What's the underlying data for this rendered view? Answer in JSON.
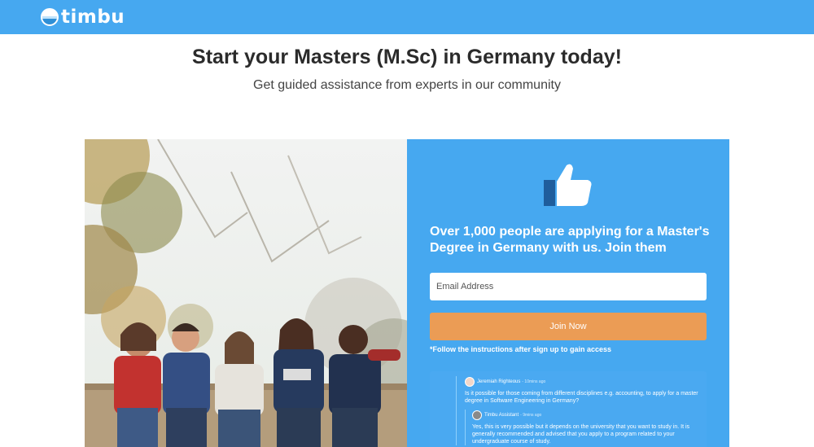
{
  "brand": {
    "name": "timbu"
  },
  "hero": {
    "title": "Start your Masters (M.Sc) in Germany today!",
    "subtitle": "Get guided assistance from experts in our community"
  },
  "signup": {
    "title": "Over 1,000 people are applying for a Master's Degree in Germany with us. Join them",
    "email_placeholder": "Email Address",
    "button_label": "Join Now",
    "note": "*Follow the instructions after sign up to gain access"
  },
  "chat": {
    "messages": [
      {
        "author": "Jeremiah Righteous",
        "time": "- 10mins ago",
        "text": "Is it possible for those coming from different disciplines e.g. accounting, to apply for a master degree in Software Engineering in Germany?"
      },
      {
        "author": "Timbu Assistant",
        "time": "- 9mins ago",
        "text": "Yes, this is very possible but it depends on the university that you want to study in. It is generally recommended and advised that you apply to a program related to your undergraduate course of study."
      }
    ]
  },
  "colors": {
    "header": "#46a8f0",
    "panel": "#46a8f0",
    "button": "#eb9c55"
  },
  "icons": {
    "logo": "globe-logo-icon",
    "thumbs": "thumbs-up-icon"
  }
}
